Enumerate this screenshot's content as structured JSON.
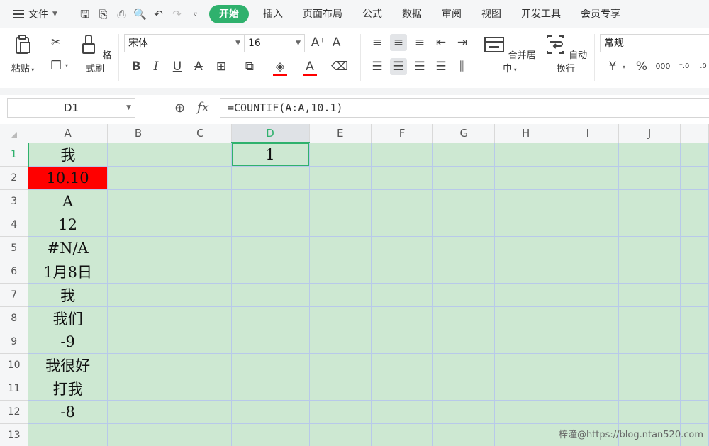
{
  "menubar": {
    "file_label": "文件",
    "tabs": [
      "开始",
      "插入",
      "页面布局",
      "公式",
      "数据",
      "审阅",
      "视图",
      "开发工具",
      "会员专享"
    ]
  },
  "ribbon": {
    "paste_label": "粘贴",
    "format_painter_label": "格式刷",
    "font_name": "宋体",
    "font_size": "16",
    "merge_center_label": "合并居中",
    "wrap_text_label": "自动换行",
    "number_format": "常规",
    "currency_symbol": "¥",
    "percent_symbol": "%",
    "thousands_symbol": "000",
    "font_color": "#ff0000",
    "fill_color": "#ff0000"
  },
  "formula_bar": {
    "name_box": "D1",
    "fx": "fx",
    "formula": "=COUNTIF(A:A,10.1)"
  },
  "grid": {
    "columns": [
      "A",
      "B",
      "C",
      "D",
      "E",
      "F",
      "G",
      "H",
      "I",
      "J"
    ],
    "rows": [
      "1",
      "2",
      "3",
      "4",
      "5",
      "6",
      "7",
      "8",
      "9",
      "10",
      "11",
      "12",
      "13"
    ],
    "colA": [
      "我",
      "10.10",
      "A",
      "12",
      "#N/A",
      "1月8日",
      "我",
      "我们",
      "-9",
      "我很好",
      "打我",
      "-8",
      ""
    ],
    "D1": "1",
    "selected_cell": "D1",
    "highlight_color": "#ff0000",
    "sheet_bg": "#cde8d2"
  },
  "watermark": "梓潼@https://blog.ntan520.com"
}
